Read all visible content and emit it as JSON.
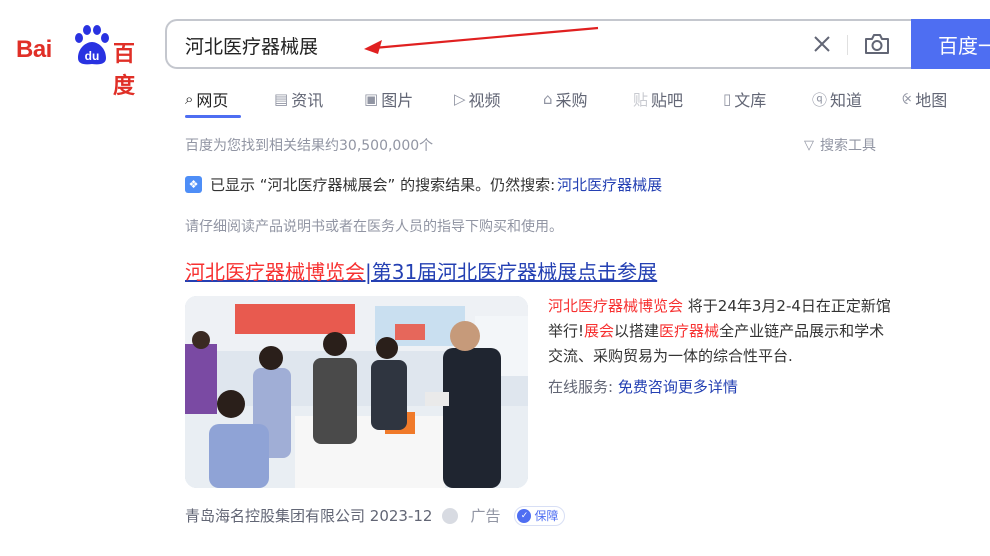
{
  "logo": {
    "bai": "Bai",
    "du": "du",
    "cn": "百度"
  },
  "search": {
    "value": "河北医疗器械展",
    "button_label": "百度一下"
  },
  "tabs": [
    {
      "label": "网页",
      "icon": "search-icon"
    },
    {
      "label": "资讯",
      "icon": "news-icon"
    },
    {
      "label": "图片",
      "icon": "image-icon"
    },
    {
      "label": "视频",
      "icon": "video-icon"
    },
    {
      "label": "采购",
      "icon": "purchase-icon"
    },
    {
      "label": "贴吧",
      "icon": "tieba-icon"
    },
    {
      "label": "文库",
      "icon": "wenku-icon"
    },
    {
      "label": "知道",
      "icon": "question-icon"
    },
    {
      "label": "地图",
      "icon": "map-icon"
    }
  ],
  "result_count": "百度为您找到相关结果约30,500,000个",
  "search_tools": "搜索工具",
  "notice": {
    "text": "已显示 “河北医疗器械展会” 的搜索结果。仍然搜索:",
    "link": "河北医疗器械展"
  },
  "disclaimer": "请仔细阅读产品说明书或者在医务人员的指导下购买和使用。",
  "result": {
    "title_em": "河北医疗器械博览会",
    "title_rest": "|第31届河北医疗器械展点击参展",
    "snippet_em1": "河北医疗器械博览会",
    "snippet_t1": " 将于24年3月2-4日在正定新馆举行!",
    "snippet_em2": "展会",
    "snippet_t2": "以搭建",
    "snippet_em3": "医疗器械",
    "snippet_t3": "全产业链产品展示和学术交流、采购贸易为一体的综合性平台.",
    "service_label": "在线服务: ",
    "service_link": "免费咨询更多详情",
    "company": "青岛海名控股集团有限公司 2023-12",
    "ad_label": "广告",
    "badge": "保障"
  }
}
